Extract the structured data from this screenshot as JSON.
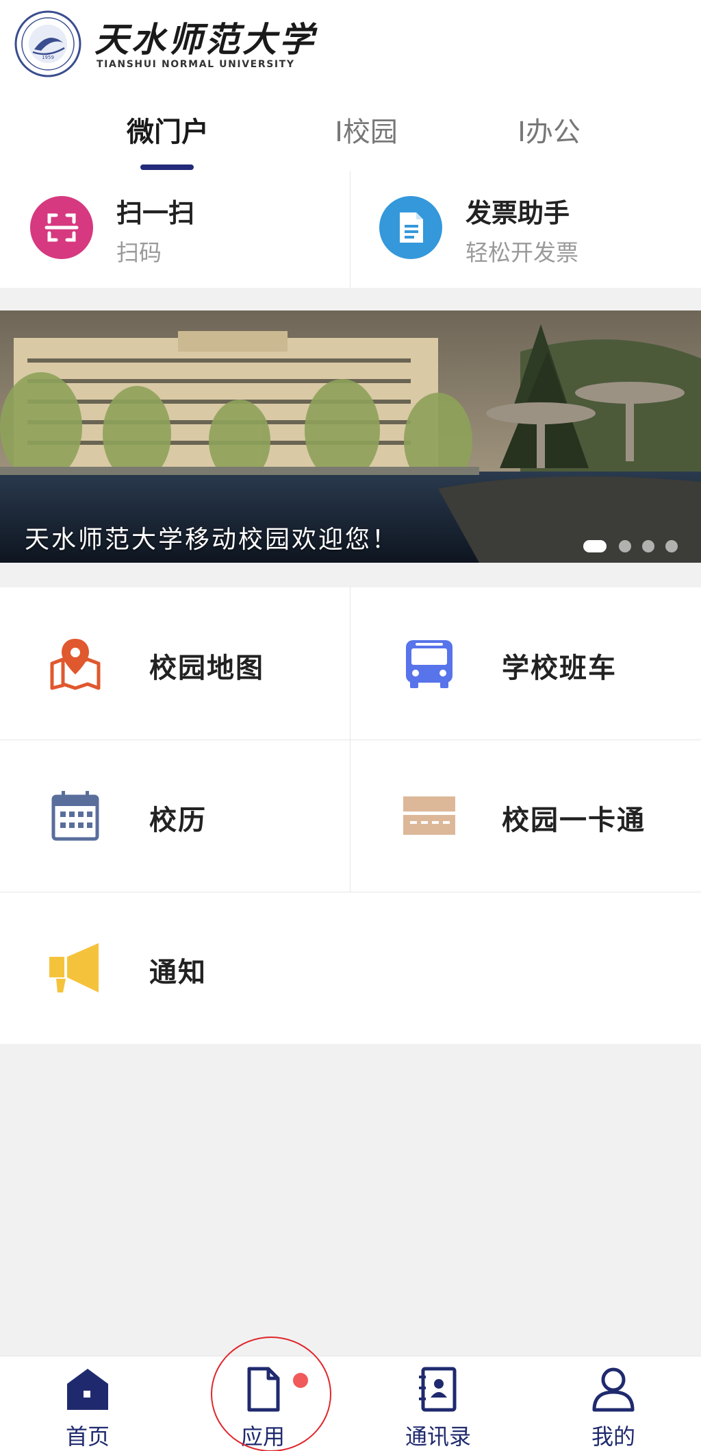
{
  "header": {
    "logo_cn": "天水师范大学",
    "logo_en": "TIANSHUI NORMAL UNIVERSITY"
  },
  "tabs": [
    {
      "label": "微门户",
      "active": true
    },
    {
      "label": "I校园",
      "active": false
    },
    {
      "label": "I办公",
      "active": false
    }
  ],
  "quick_actions": [
    {
      "title": "扫一扫",
      "subtitle": "扫码",
      "icon": "scan-icon",
      "color": "#d6397f"
    },
    {
      "title": "发票助手",
      "subtitle": "轻松开发票",
      "icon": "invoice-icon",
      "color": "#3498db"
    }
  ],
  "banner": {
    "caption": "天水师范大学移动校园欢迎您！",
    "slide_count": 4,
    "active_slide": 1
  },
  "apps": [
    {
      "label": "校园地图",
      "icon": "map-pin-icon",
      "color": "#e0582e"
    },
    {
      "label": "学校班车",
      "icon": "bus-icon",
      "color": "#5874ea"
    },
    {
      "label": "校历",
      "icon": "calendar-icon",
      "color": "#5a6e9c"
    },
    {
      "label": "校园一卡通",
      "icon": "card-icon",
      "color": "#dcb899"
    },
    {
      "label": "通知",
      "icon": "megaphone-icon",
      "color": "#f5c33b"
    }
  ],
  "bottom_nav": [
    {
      "label": "首页",
      "icon": "home-icon"
    },
    {
      "label": "应用",
      "icon": "document-icon",
      "badge": true
    },
    {
      "label": "通讯录",
      "icon": "contacts-icon"
    },
    {
      "label": "我的",
      "icon": "user-icon"
    }
  ],
  "colors": {
    "accent": "#232a7a",
    "nav": "#1f2a6e",
    "badge": "#f05a5a"
  }
}
